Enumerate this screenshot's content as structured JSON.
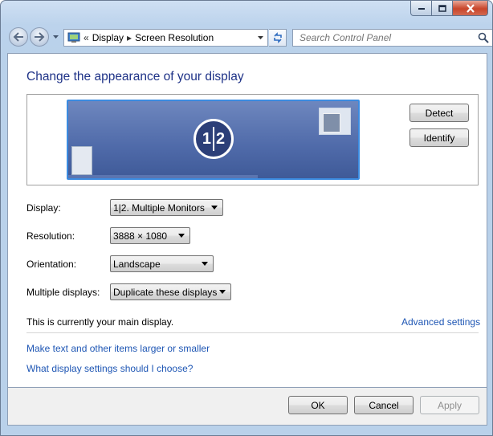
{
  "window": {
    "caption_buttons": {
      "minimize_icon": "minimize-icon",
      "maximize_icon": "maximize-icon",
      "close_icon": "close-icon"
    }
  },
  "navigation": {
    "breadcrumb_prefix": "«",
    "breadcrumbs": [
      "Display",
      "Screen Resolution"
    ],
    "breadcrumb_separator": "▸",
    "search_placeholder": "Search Control Panel"
  },
  "main": {
    "title": "Change the appearance of your display",
    "preview": {
      "monitor_label_left": "1",
      "monitor_label_right": "2"
    },
    "buttons": {
      "detect": "Detect",
      "identify": "Identify"
    },
    "settings": {
      "display_label": "Display:",
      "display_value": "1|2. Multiple Monitors",
      "resolution_label": "Resolution:",
      "resolution_value": "3888 × 1080",
      "orientation_label": "Orientation:",
      "orientation_value": "Landscape",
      "multiple_label": "Multiple displays:",
      "multiple_value": "Duplicate these displays"
    },
    "status_text": "This is currently your main display.",
    "advanced_link": "Advanced settings",
    "links": [
      "Make text and other items larger or smaller",
      "What display settings should I choose?"
    ]
  },
  "footer": {
    "ok": "OK",
    "cancel": "Cancel",
    "apply": "Apply"
  },
  "colors": {
    "title": "#1e3287",
    "link": "#1e56b4",
    "monitor_border": "#3b8be0"
  }
}
